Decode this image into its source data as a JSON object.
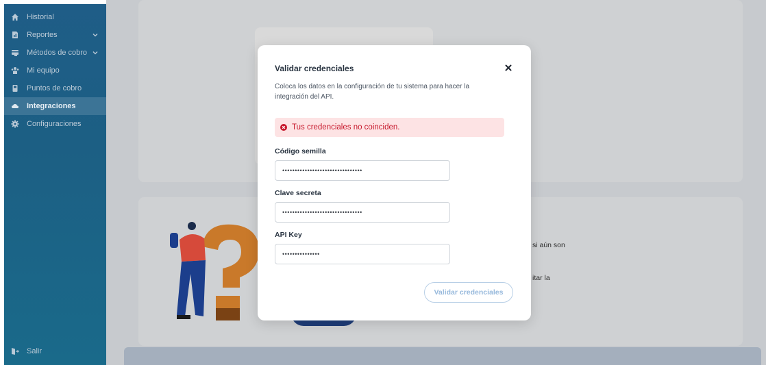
{
  "sidebar": {
    "items": [
      {
        "label": "Historial",
        "icon": "home-icon",
        "has_chevron": false,
        "active": false
      },
      {
        "label": "Reportes",
        "icon": "document-icon",
        "has_chevron": true,
        "active": false
      },
      {
        "label": "Métodos de cobro",
        "icon": "payment-icon",
        "has_chevron": true,
        "active": false
      },
      {
        "label": "Mi equipo",
        "icon": "team-icon",
        "has_chevron": false,
        "active": false
      },
      {
        "label": "Puntos de cobro",
        "icon": "device-icon",
        "has_chevron": false,
        "active": false
      },
      {
        "label": "Integraciones",
        "icon": "cloud-icon",
        "has_chevron": false,
        "active": true
      },
      {
        "label": "Configuraciones",
        "icon": "gear-icon",
        "has_chevron": false,
        "active": false
      }
    ],
    "logout_label": "Salir"
  },
  "background": {
    "peek_text_1": "si aún son",
    "peek_text_2": "itar la"
  },
  "modal": {
    "title": "Validar credenciales",
    "description": "Coloca los datos en la configuración de tu sistema para hacer la integración del API.",
    "alert_text": "Tus credenciales no coinciden.",
    "fields": [
      {
        "label": "Código semilla",
        "value": "••••••••••••••••••••••••••••••••"
      },
      {
        "label": "Clave secreta",
        "value": "••••••••••••••••••••••••••••••••"
      },
      {
        "label": "API Key",
        "value": "•••••••••••••••"
      }
    ],
    "submit_label": "Validar credenciales"
  },
  "colors": {
    "sidebar": "#1f5d87",
    "alert_bg": "#fde3e4",
    "alert_text": "#c7182c",
    "button_border": "#b8cfe6"
  }
}
